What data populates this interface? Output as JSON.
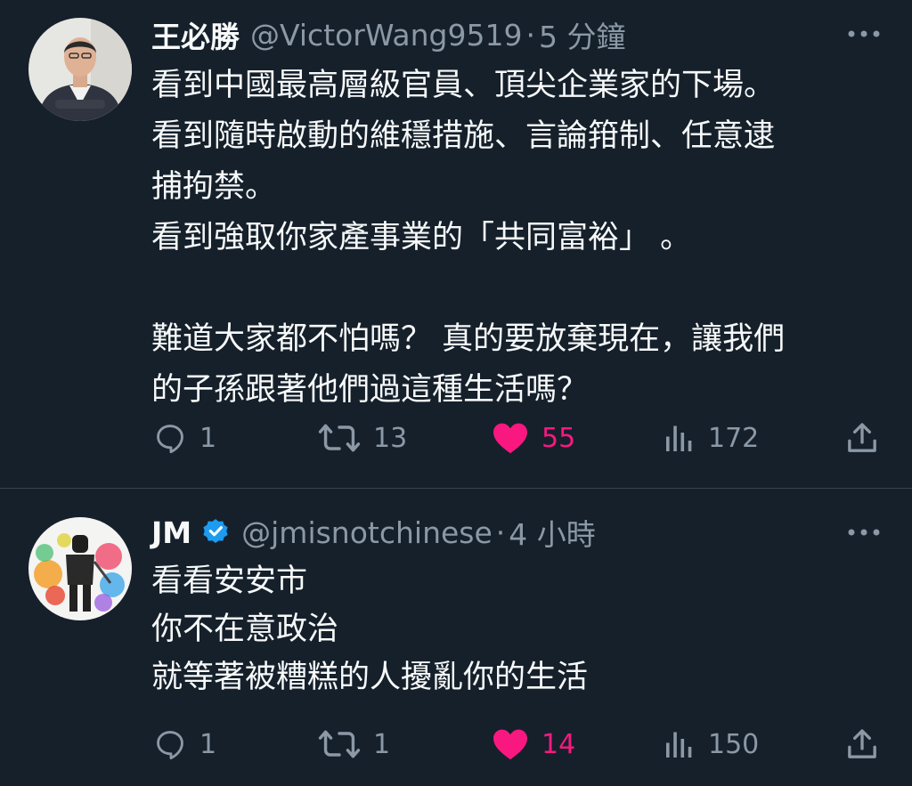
{
  "tweets": [
    {
      "name": "王必勝",
      "handle": "@VictorWang9519",
      "separator": "·",
      "time": "5 分鐘",
      "lines": [
        "看到中國最高層級官員、頂尖企業家的下場。",
        "看到隨時啟動的維穩措施、言論箝制、任意逮",
        "捕拘禁。",
        "看到強取你家產事業的「共同富裕」 。",
        "",
        "難道大家都不怕嗎？ 真的要放棄現在，讓我們",
        "的子孫跟著他們過這種生活嗎？"
      ],
      "replies": "1",
      "retweets": "13",
      "likes": "55",
      "views": "172",
      "liked": true
    },
    {
      "name": "JM",
      "verified": true,
      "handle": "@jmisnotchinese",
      "separator": "·",
      "time": "4 小時",
      "lines": [
        "看看安安市",
        "你不在意政治",
        "就等著被糟糕的人擾亂你的生活"
      ],
      "replies": "1",
      "retweets": "1",
      "likes": "14",
      "views": "150",
      "liked": true
    }
  ],
  "colors": {
    "background": "#15202b",
    "text": "#f7f9f9",
    "secondary": "#8b98a5",
    "like": "#f91880",
    "verified": "#1d9bf0",
    "divider": "#38444d"
  }
}
